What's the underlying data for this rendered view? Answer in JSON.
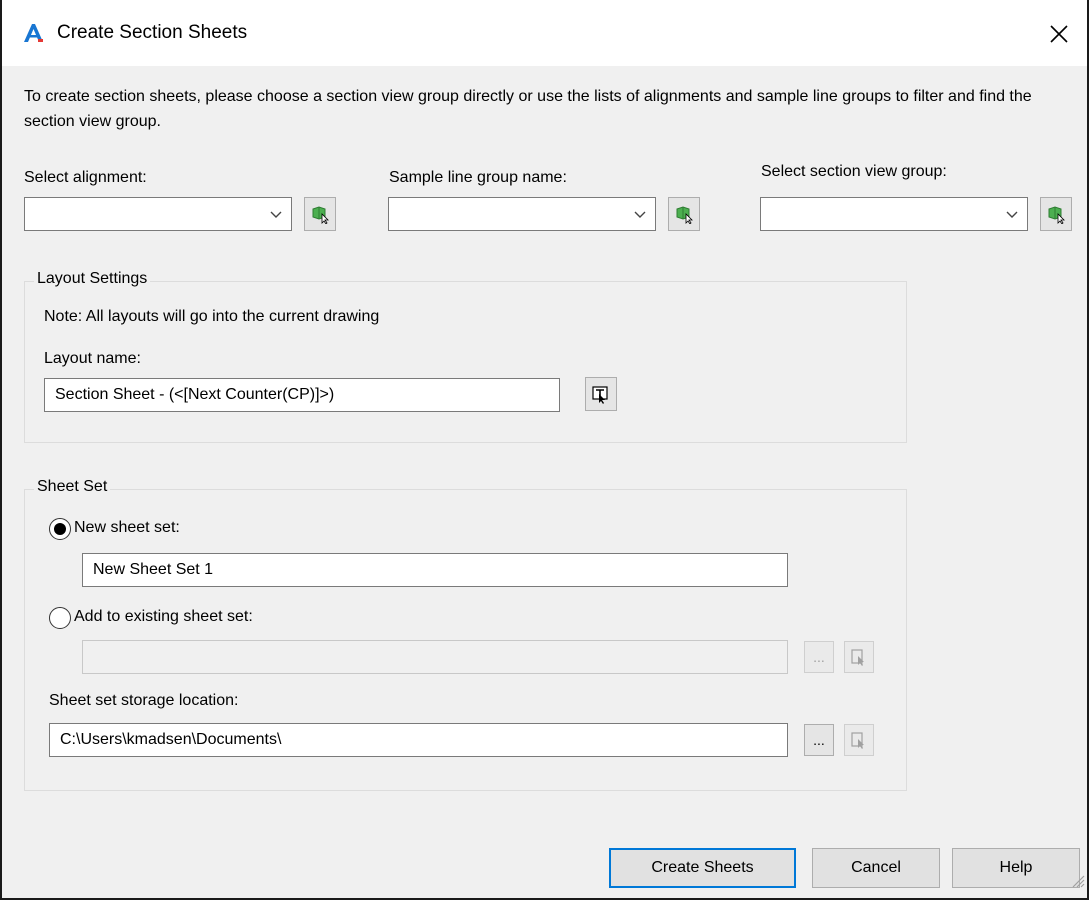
{
  "window": {
    "title": "Create Section Sheets",
    "app_icon": "autocad-a-logo",
    "close_icon": "close-icon"
  },
  "intro": "To create section sheets, please choose a section view group directly or use the lists of alignments and sample line groups to filter and find the section view group.",
  "selectors": {
    "alignment_label": "Select alignment:",
    "alignment_value": "",
    "sample_line_label": "Sample line group name:",
    "sample_line_value": "",
    "section_view_label": "Select section view group:",
    "section_view_value": ""
  },
  "layout_settings": {
    "title": "Layout Settings",
    "note": "Note: All layouts will go into the current drawing",
    "name_label": "Layout name:",
    "name_value": "Section Sheet - (<[Next Counter(CP)]>)"
  },
  "sheet_set": {
    "title": "Sheet Set",
    "new_label": "New sheet set:",
    "new_value": "New Sheet Set 1",
    "new_selected": true,
    "existing_label": "Add to existing sheet set:",
    "existing_value": "",
    "browse_label": "...",
    "storage_label": "Sheet set storage location:",
    "storage_value": "C:\\Users\\kmadsen\\Documents\\"
  },
  "buttons": {
    "create": "Create Sheets",
    "cancel": "Cancel",
    "help": "Help"
  },
  "colors": {
    "accent": "#0078d7",
    "pick_icon_green": "#4caf50"
  }
}
